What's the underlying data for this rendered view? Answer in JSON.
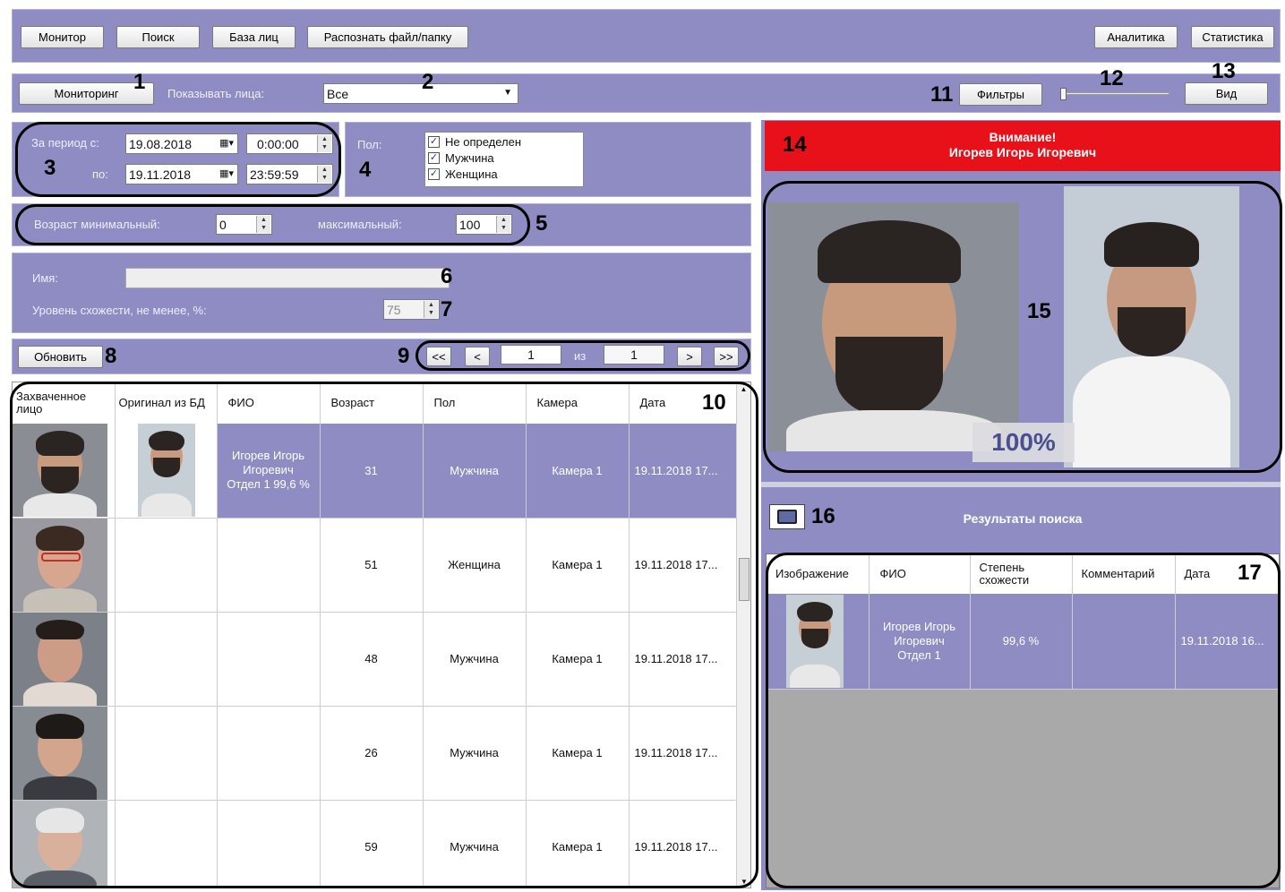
{
  "toolbar": {
    "left": [
      "Монитор",
      "Поиск",
      "База лиц",
      "Распознать файл/папку"
    ],
    "analytics": "Аналитика",
    "statistics": "Статистика"
  },
  "row2": {
    "monitoring": "Мониторинг",
    "show_faces_label": "Показывать лица:",
    "show_faces_value": "Все",
    "filters": "Фильтры",
    "view": "Вид"
  },
  "period": {
    "from_label": "За период с:",
    "to_label": "по:",
    "from_date": "19.08.2018",
    "from_time": "0:00:00",
    "to_date": "19.11.2018",
    "to_time": "23:59:59"
  },
  "gender": {
    "label": "Пол:",
    "options": [
      {
        "label": "Не определен",
        "checked": true
      },
      {
        "label": "Мужчина",
        "checked": true
      },
      {
        "label": "Женщина",
        "checked": true
      }
    ]
  },
  "age": {
    "min_label": "Возраст минимальный:",
    "min_value": "0",
    "max_label": "максимальный:",
    "max_value": "100"
  },
  "name": {
    "label": "Имя:",
    "value": ""
  },
  "similarity": {
    "label": "Уровень схожести, не менее, %:",
    "value": "75"
  },
  "refresh": "Обновить",
  "pager": {
    "first": "<<",
    "prev": "<",
    "page": "1",
    "of": "из",
    "total": "1",
    "next": ">",
    "last": ">>"
  },
  "events": {
    "headers": [
      "Захваченное лицо",
      "Оригинал из БД",
      "ФИО",
      "Возраст",
      "Пол",
      "Камера",
      "Дата"
    ],
    "rows": [
      {
        "fio": "Игорев Игорь Игоревич Отдел 1 99,6 %",
        "age": "31",
        "gender": "Мужчина",
        "camera": "Камера 1",
        "date": "19.11.2018 17...",
        "selected": true
      },
      {
        "fio": "",
        "age": "51",
        "gender": "Женщина",
        "camera": "Камера 1",
        "date": "19.11.2018 17...",
        "selected": false
      },
      {
        "fio": "",
        "age": "48",
        "gender": "Мужчина",
        "camera": "Камера 1",
        "date": "19.11.2018 17...",
        "selected": false
      },
      {
        "fio": "",
        "age": "26",
        "gender": "Мужчина",
        "camera": "Камера 1",
        "date": "19.11.2018 17...",
        "selected": false
      },
      {
        "fio": "",
        "age": "59",
        "gender": "Мужчина",
        "camera": "Камера 1",
        "date": "19.11.2018 17...",
        "selected": false
      }
    ]
  },
  "alert": {
    "line1": "Внимание!",
    "line2": "Игорев Игорь Игоревич",
    "color": "#e8111a"
  },
  "match": {
    "percent": "100%"
  },
  "search_results": {
    "title": "Результаты поиска",
    "headers": [
      "Изображение",
      "ФИО",
      "Степень схожести",
      "Комментарий",
      "Дата"
    ],
    "rows": [
      {
        "fio": "Игорев Игорь Игоревич Отдел 1",
        "similarity": "99,6 %",
        "comment": "",
        "date": "19.11.2018 16..."
      }
    ]
  },
  "callouts": [
    "1",
    "2",
    "3",
    "4",
    "5",
    "6",
    "7",
    "8",
    "9",
    "10",
    "11",
    "12",
    "13",
    "14",
    "15",
    "16",
    "17"
  ],
  "colors": {
    "panel": "#8e8cc2",
    "selected_row": "#8e8cc2",
    "alert": "#e8111a",
    "empty_area": "#a9a9a9"
  }
}
